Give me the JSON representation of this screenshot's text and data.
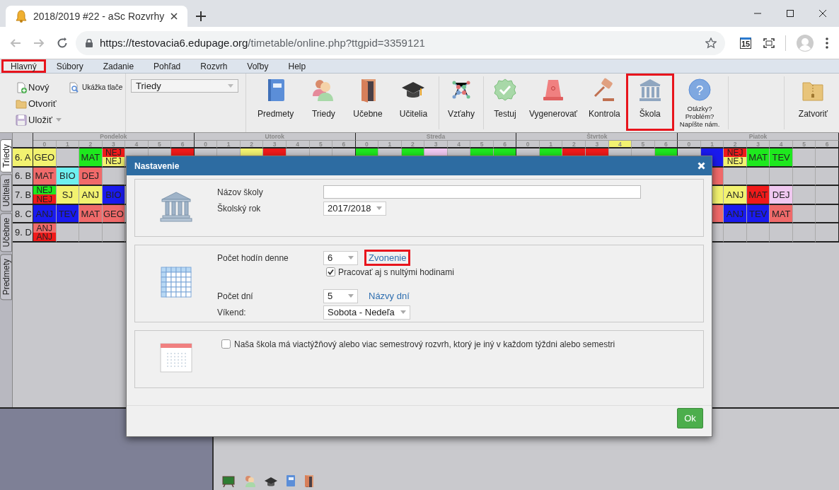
{
  "browser": {
    "tab_title": "2018/2019 #22 - aSc Rozvrhy",
    "url_host": "https://testovacia6.edupage.org",
    "url_path": "/timetable/online.php?ttgpid=3359121",
    "extension_badge": "15"
  },
  "menu": [
    {
      "label": "Hlavný",
      "selected": true,
      "highlighted": true
    },
    {
      "label": "Súbory",
      "selected": false,
      "highlighted": false
    },
    {
      "label": "Zadanie",
      "selected": false,
      "highlighted": false
    },
    {
      "label": "Pohľad",
      "selected": false,
      "highlighted": false
    },
    {
      "label": "Rozvrh",
      "selected": false,
      "highlighted": false
    },
    {
      "label": "Voľby",
      "selected": false,
      "highlighted": false
    },
    {
      "label": "Help",
      "selected": false,
      "highlighted": false
    }
  ],
  "ribbon": {
    "file_buttons": [
      {
        "label": "Nový",
        "kind": "new",
        "dropdown": false
      },
      {
        "label": "Ukážka tlače",
        "kind": "preview",
        "dropdown": false
      },
      {
        "label": "Otvoriť",
        "kind": "open",
        "dropdown": false
      },
      {
        "label": "Uložiť",
        "kind": "save",
        "dropdown": true
      }
    ],
    "view_select": "Triedy",
    "button_groups": [
      {
        "buttons": [
          {
            "label": "Predmety",
            "kind": "book",
            "highlighted": false
          },
          {
            "label": "Triedy",
            "kind": "people",
            "highlighted": false
          },
          {
            "label": "Učebne",
            "kind": "door",
            "highlighted": false
          },
          {
            "label": "Učitelia",
            "kind": "cap",
            "highlighted": false
          }
        ]
      },
      {
        "buttons": [
          {
            "label": "Vzťahy",
            "kind": "network",
            "highlighted": false
          }
        ]
      },
      {
        "buttons": [
          {
            "label": "Testuj",
            "kind": "check",
            "highlighted": false
          },
          {
            "label": "Vygenerovať",
            "kind": "siren",
            "highlighted": false
          },
          {
            "label": "Kontrola",
            "kind": "gavel",
            "highlighted": false
          },
          {
            "label": "Škola",
            "kind": "bank",
            "highlighted": true
          },
          {
            "label": "Otázky?\nProblém?\nNapíšte nám.",
            "kind": "help",
            "icon_text": "?",
            "highlighted": false
          }
        ]
      },
      {
        "buttons": [
          {
            "label": "Zatvoriť",
            "kind": "zip",
            "highlighted": false
          }
        ]
      }
    ]
  },
  "side_tabs": [
    {
      "label": "Triedy",
      "selected": true
    },
    {
      "label": "Učitelia",
      "selected": false
    },
    {
      "label": "Učebne",
      "selected": false
    },
    {
      "label": "Predmety",
      "selected": false
    }
  ],
  "timetable": {
    "days": [
      {
        "name": "Pondelok",
        "periods": [
          {
            "label": "0",
            "current": false
          },
          {
            "label": "1",
            "current": false
          },
          {
            "label": "2",
            "current": false
          },
          {
            "label": "3",
            "current": false
          },
          {
            "label": "4",
            "current": false
          },
          {
            "label": "5",
            "current": false
          },
          {
            "label": "6",
            "current": false
          }
        ]
      },
      {
        "name": "Utorok",
        "periods": [
          {
            "label": "0",
            "current": false
          },
          {
            "label": "1",
            "current": false
          },
          {
            "label": "2",
            "current": false
          },
          {
            "label": "3",
            "current": false
          },
          {
            "label": "4",
            "current": false
          },
          {
            "label": "5",
            "current": false
          },
          {
            "label": "6",
            "current": false
          }
        ]
      },
      {
        "name": "Streda",
        "periods": [
          {
            "label": "0",
            "current": false
          },
          {
            "label": "1",
            "current": false
          },
          {
            "label": "2",
            "current": false
          },
          {
            "label": "3",
            "current": false
          },
          {
            "label": "4",
            "current": false
          },
          {
            "label": "5",
            "current": false
          },
          {
            "label": "6",
            "current": false
          }
        ]
      },
      {
        "name": "Štvrtok",
        "periods": [
          {
            "label": "0",
            "current": false
          },
          {
            "label": "1",
            "current": false
          },
          {
            "label": "2",
            "current": false
          },
          {
            "label": "3",
            "current": false
          },
          {
            "label": "4",
            "current": true
          },
          {
            "label": "5",
            "current": false
          },
          {
            "label": "6",
            "current": false
          }
        ]
      },
      {
        "name": "Piatok",
        "periods": [
          {
            "label": "0",
            "current": false
          },
          {
            "label": "1",
            "current": false
          },
          {
            "label": "2",
            "current": false
          },
          {
            "label": "3",
            "current": false
          },
          {
            "label": "4",
            "current": false
          },
          {
            "label": "5",
            "current": false
          },
          {
            "label": "6",
            "current": false
          }
        ]
      }
    ],
    "rows": [
      {
        "class": "6. A",
        "selected": true,
        "cells": [
          {
            "parts": [
              {
                "text": "GEO",
                "color": "#f2f270"
              }
            ]
          },
          {},
          {
            "parts": [
              {
                "text": "MAT",
                "color": "#1ee81e"
              }
            ]
          },
          {
            "parts": [
              {
                "text": "NEJ",
                "color": "#f01a1a"
              },
              {
                "text": "NEJ",
                "color": "#f2f270"
              }
            ]
          },
          {},
          {},
          {
            "parts": [
              {
                "color": "#f01a1a"
              }
            ]
          },
          {},
          {},
          {
            "parts": [
              {
                "color": "#f2f270"
              }
            ]
          },
          {
            "parts": [
              {
                "color": "#f01a1a"
              }
            ]
          },
          {},
          {},
          {},
          {
            "parts": [
              {
                "color": "#1ee81e"
              }
            ]
          },
          {},
          {
            "parts": [
              {
                "color": "#1ee81e"
              }
            ]
          },
          {
            "parts": [
              {
                "color": "#f0c8f0"
              }
            ]
          },
          {},
          {
            "parts": [
              {
                "color": "#1ee81e"
              }
            ]
          },
          {
            "parts": [
              {
                "color": "#1ee81e"
              }
            ]
          },
          {},
          {
            "parts": [
              {
                "color": "#1ee81e"
              }
            ]
          },
          {
            "parts": [
              {
                "color": "#f01a1a"
              }
            ]
          },
          {
            "parts": [
              {
                "color": "#f01a1a"
              }
            ]
          },
          {},
          {},
          {
            "parts": [
              {
                "color": "#1ee81e"
              }
            ]
          },
          {},
          {
            "parts": [
              {
                "color": "#1a1aee"
              }
            ]
          },
          {
            "parts": [
              {
                "text": "NEJ",
                "color": "#f01a1a"
              },
              {
                "text": "NEJ",
                "color": "#f2f270"
              }
            ]
          },
          {
            "parts": [
              {
                "text": "MAT",
                "color": "#1ee81e"
              }
            ]
          },
          {
            "parts": [
              {
                "text": "TEV",
                "color": "#1ee81e"
              }
            ]
          },
          {},
          {}
        ]
      },
      {
        "class": "6. B",
        "selected": false,
        "cells": [
          {
            "parts": [
              {
                "text": "MAT",
                "color": "#f06a6a"
              }
            ]
          },
          {
            "parts": [
              {
                "text": "BIO",
                "color": "#6ef0f0"
              }
            ]
          },
          {
            "parts": [
              {
                "text": "DEJ",
                "color": "#f06a6a"
              }
            ]
          },
          {},
          {},
          {},
          {},
          {},
          {},
          {},
          {},
          {},
          {},
          {},
          {},
          {},
          {},
          {},
          {},
          {},
          {},
          {},
          {},
          {},
          {},
          {},
          {},
          {},
          {},
          {
            "parts": [
              {
                "color": "#f06a6a"
              }
            ]
          },
          {},
          {},
          {},
          {},
          {}
        ]
      },
      {
        "class": "7. B",
        "selected": false,
        "cells": [
          {
            "parts": [
              {
                "text": "NEJ",
                "color": "#1ee81e"
              },
              {
                "text": "NEJ",
                "color": "#f01a1a"
              }
            ]
          },
          {
            "parts": [
              {
                "text": "SJ",
                "color": "#f2f270"
              }
            ]
          },
          {
            "parts": [
              {
                "text": "ANJ",
                "color": "#f2f270"
              }
            ]
          },
          {
            "parts": [
              {
                "text": "BIO",
                "color": "#1a1aee"
              }
            ]
          },
          {},
          {},
          {},
          {},
          {},
          {},
          {},
          {},
          {},
          {},
          {},
          {},
          {},
          {},
          {},
          {},
          {},
          {},
          {},
          {},
          {},
          {},
          {},
          {},
          {},
          {
            "parts": [
              {
                "color": "#f2f270"
              }
            ]
          },
          {
            "parts": [
              {
                "text": "ANJ",
                "color": "#f2f270"
              }
            ]
          },
          {
            "parts": [
              {
                "text": "MAT",
                "color": "#f01a1a"
              }
            ]
          },
          {
            "parts": [
              {
                "text": "DEJ",
                "color": "#f0c8f0"
              }
            ]
          },
          {},
          {}
        ]
      },
      {
        "class": "8. C",
        "selected": false,
        "cells": [
          {
            "parts": [
              {
                "text": "ANJ",
                "color": "#1a1aee"
              }
            ]
          },
          {
            "parts": [
              {
                "text": "TEV",
                "color": "#1a1aee"
              }
            ]
          },
          {
            "parts": [
              {
                "text": "MAT",
                "color": "#f06a6a"
              }
            ]
          },
          {
            "parts": [
              {
                "text": "GEO",
                "color": "#f06a6a"
              }
            ]
          },
          {},
          {},
          {},
          {},
          {},
          {},
          {},
          {},
          {},
          {},
          {},
          {},
          {},
          {},
          {},
          {},
          {},
          {},
          {},
          {},
          {},
          {},
          {},
          {},
          {},
          {
            "parts": [
              {
                "color": "#f06a6a"
              }
            ]
          },
          {
            "parts": [
              {
                "text": "ANJ",
                "color": "#1a1aee"
              }
            ]
          },
          {
            "parts": [
              {
                "text": "TEV",
                "color": "#1a1aee"
              }
            ]
          },
          {
            "parts": [
              {
                "text": "MAT",
                "color": "#f06a6a"
              }
            ]
          },
          {},
          {}
        ]
      },
      {
        "class": "9. D",
        "selected": false,
        "cells": [
          {
            "parts": [
              {
                "text": "ANJ",
                "color": "#f06a6a"
              },
              {
                "text": "ANJ",
                "color": "#f01a1a"
              }
            ]
          },
          {},
          {},
          {},
          {},
          {},
          {},
          {},
          {},
          {},
          {},
          {},
          {},
          {},
          {},
          {},
          {},
          {},
          {},
          {},
          {},
          {},
          {},
          {},
          {},
          {},
          {},
          {},
          {},
          {},
          {},
          {},
          {},
          {},
          {}
        ]
      }
    ]
  },
  "dialog": {
    "title": "Nastavenie",
    "sections": [
      {
        "kind": "school",
        "fields": [
          {
            "kind": "text",
            "label": "Názov školy"
          },
          {
            "kind": "select",
            "label": "Školský rok",
            "value": "2017/2018"
          }
        ]
      },
      {
        "kind": "lessons",
        "fields": [
          {
            "kind": "select",
            "label": "Počet hodín denne",
            "value": "6",
            "link": {
              "text": "Zvonenie",
              "highlighted": true
            }
          },
          {
            "kind": "check",
            "label": "Pracovať aj s nultými hodinami",
            "checked": true
          },
          {
            "kind": "select",
            "label": "Počet dní",
            "value": "5",
            "link": {
              "text": "Názvy dní",
              "highlighted": false
            }
          },
          {
            "kind": "select",
            "label": "Víkend:",
            "value": "Sobota - Nedeľa"
          }
        ]
      },
      {
        "kind": "weeks",
        "fields": [
          {
            "kind": "option",
            "label": "Naša škola má viactýžňový alebo viac semestrový rozvrh, ktorý je iný v každom týždni alebo semestri",
            "checked": false
          }
        ]
      }
    ],
    "ok_button": "Ok"
  }
}
